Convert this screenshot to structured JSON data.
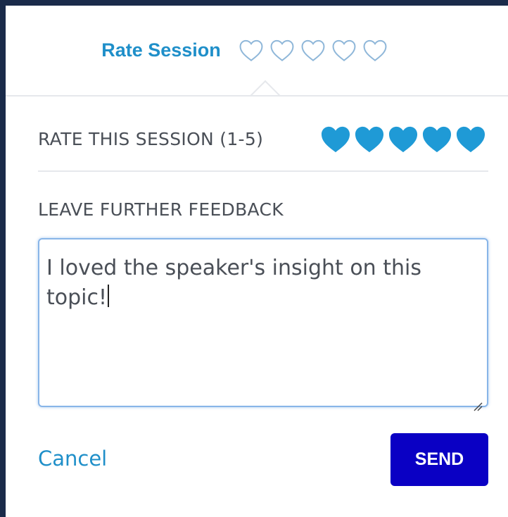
{
  "header": {
    "title": "Rate Session",
    "header_hearts": [
      "heart-outline-icon",
      "heart-outline-icon",
      "heart-outline-icon",
      "heart-outline-icon",
      "heart-outline-icon"
    ]
  },
  "rating": {
    "label": "RATE THIS SESSION (1-5)",
    "value": 5,
    "max": 5,
    "icon": "heart-filled-icon"
  },
  "feedback": {
    "label": "LEAVE FURTHER FEEDBACK",
    "value": "I loved the speaker's insight on this topic!"
  },
  "actions": {
    "cancel_label": "Cancel",
    "send_label": "SEND"
  },
  "colors": {
    "accent": "#1f8fc9",
    "send_button": "#0a00c4",
    "label_text": "#4a4f57",
    "heart_outline": "#8fb7d9",
    "heart_filled": "#1f9ad6"
  }
}
